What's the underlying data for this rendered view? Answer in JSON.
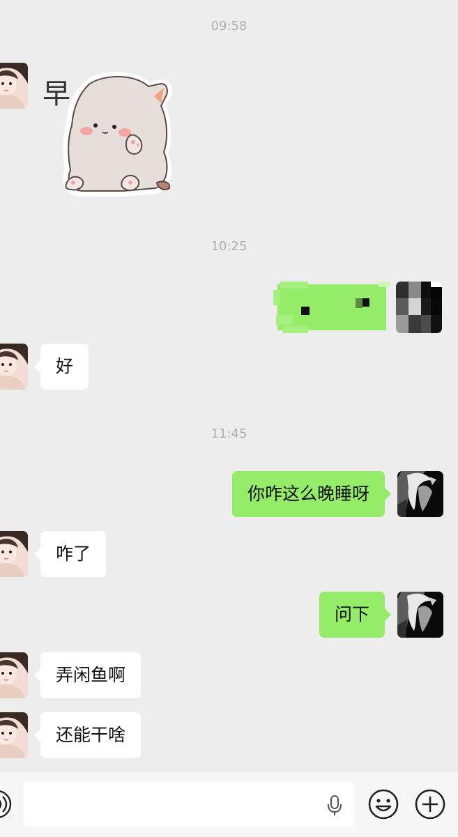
{
  "chat": {
    "timestamps": [
      "09:58",
      "10:25",
      "11:45"
    ],
    "sticker": {
      "text": "早"
    },
    "messages": {
      "m1": "好",
      "m2": "你咋这么晚睡呀",
      "m3": "咋了",
      "m4": "问下",
      "m5": "弄闲鱼啊",
      "m6": "还能干啥"
    }
  },
  "input_bar": {
    "icons": [
      "voice-toggle-icon",
      "microphone-icon",
      "emoji-icon",
      "add-icon"
    ]
  },
  "colors": {
    "background": "#EDEDED",
    "outgoing_bubble": "#95EC69",
    "incoming_bubble": "#FFFFFF",
    "timestamp": "#AFAFAF"
  }
}
